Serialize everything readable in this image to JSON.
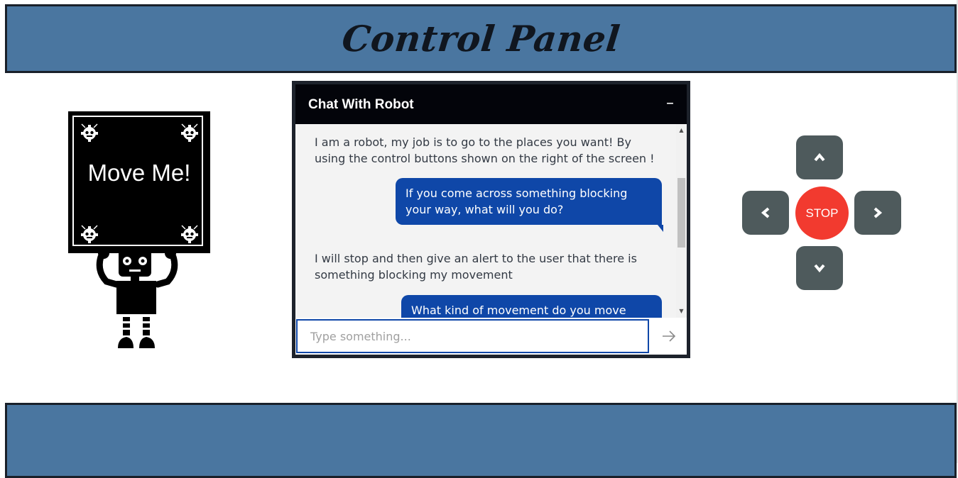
{
  "header": {
    "title": "Control Panel"
  },
  "robot": {
    "sign_text": "Move Me!",
    "icon": "robot-holding-sign-icon"
  },
  "chat": {
    "title": "Chat With Robot",
    "minimize_label": "–",
    "messages": [
      {
        "sender": "robot",
        "text": "I am a robot, my job is to go to the places you want! By using the control buttons shown on the right of the screen !"
      },
      {
        "sender": "user",
        "text": "If you come across something blocking your way, what will you do?"
      },
      {
        "sender": "robot",
        "text": "I will stop and then give an alert to the user that there is something blocking my movement"
      },
      {
        "sender": "user",
        "text": "What kind of movement do you move with?"
      }
    ],
    "input_placeholder": "Type something...",
    "input_value": "",
    "send_icon": "arrow-right-icon"
  },
  "controls": {
    "up_icon": "chevron-up-icon",
    "down_icon": "chevron-down-icon",
    "left_icon": "chevron-left-icon",
    "right_icon": "chevron-right-icon",
    "stop_label": "STOP"
  },
  "colors": {
    "header_bg": "#4a76a0",
    "border": "#19202a",
    "chat_user_bubble": "#0f47a8",
    "control_button": "#4e5a5c",
    "stop_button": "#f23a2f"
  }
}
